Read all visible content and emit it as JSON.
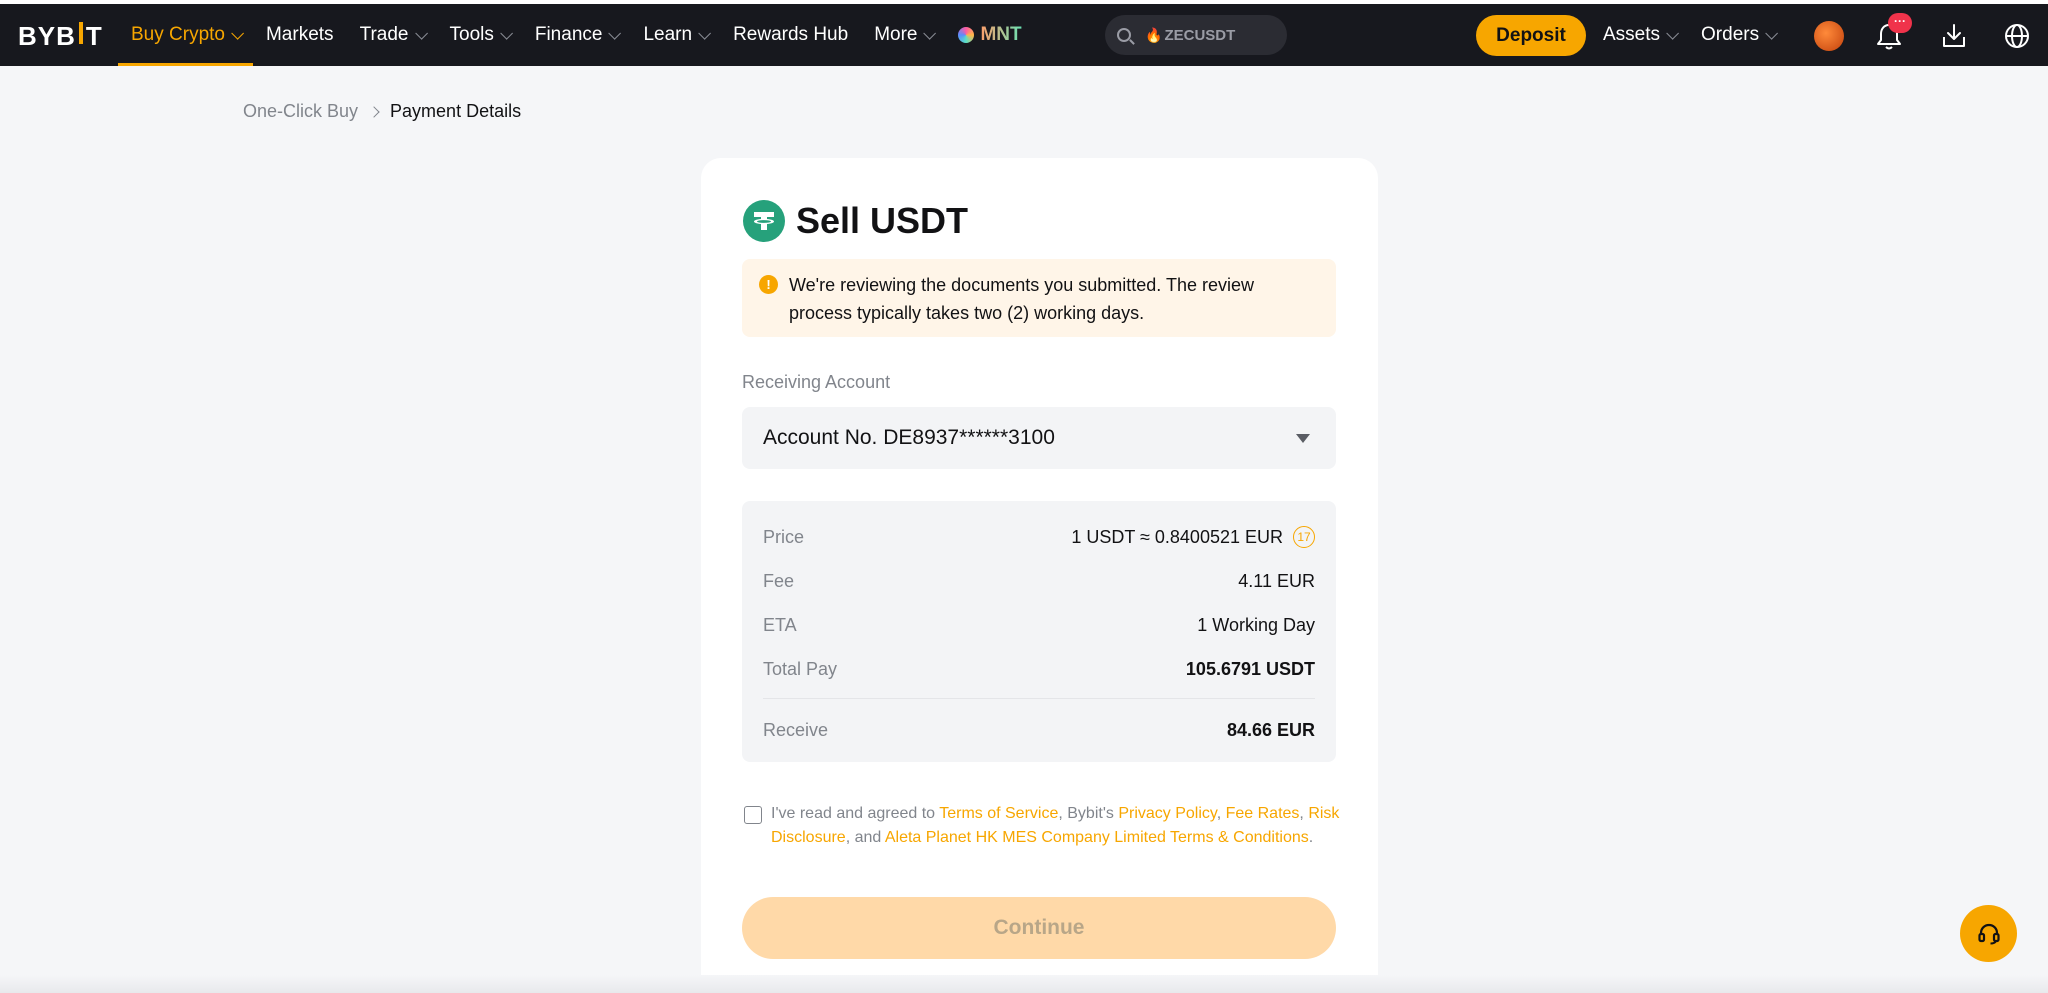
{
  "nav": {
    "logo": "BYBIT",
    "items": [
      {
        "label": "Buy Crypto",
        "dropdown": true,
        "active": true
      },
      {
        "label": "Markets",
        "dropdown": false
      },
      {
        "label": "Trade",
        "dropdown": true
      },
      {
        "label": "Tools",
        "dropdown": true
      },
      {
        "label": "Finance",
        "dropdown": true
      },
      {
        "label": "Learn",
        "dropdown": true
      },
      {
        "label": "Rewards Hub",
        "dropdown": false
      },
      {
        "label": "More",
        "dropdown": true
      }
    ],
    "mnt_label": "MNT",
    "search_text": "ZECUSDT",
    "deposit_label": "Deposit",
    "assets_label": "Assets",
    "orders_label": "Orders",
    "notification_badge": "···"
  },
  "breadcrumb": {
    "parent": "One-Click Buy",
    "current": "Payment Details"
  },
  "card": {
    "title": "Sell USDT",
    "notice": "We're reviewing the documents you submitted. The review process typically takes two (2) working days.",
    "receiving_label": "Receiving Account",
    "account_value": "Account No. DE8937******3100",
    "summary": {
      "price_label": "Price",
      "price_value": "1 USDT ≈ 0.8400521 EUR",
      "price_timer": "17",
      "fee_label": "Fee",
      "fee_value": "4.11 EUR",
      "eta_label": "ETA",
      "eta_value": "1 Working Day",
      "total_label": "Total Pay",
      "total_value": "105.6791 USDT",
      "receive_label": "Receive",
      "receive_value": "84.66 EUR"
    },
    "agreement": {
      "prefix": "I've read and agreed to ",
      "terms": "Terms of Service",
      "mid1": ", Bybit's ",
      "privacy": "Privacy Policy",
      "sep1": ", ",
      "fees": "Fee Rates",
      "sep2": ", ",
      "risk": "Risk Disclosure",
      "mid2": ", and ",
      "aleta": "Aleta Planet HK MES Company Limited Terms & Conditions",
      "suffix": "."
    },
    "continue_label": "Continue"
  },
  "colors": {
    "accent": "#f7a600",
    "nav_bg": "#17181e",
    "tether": "#26a17b"
  }
}
